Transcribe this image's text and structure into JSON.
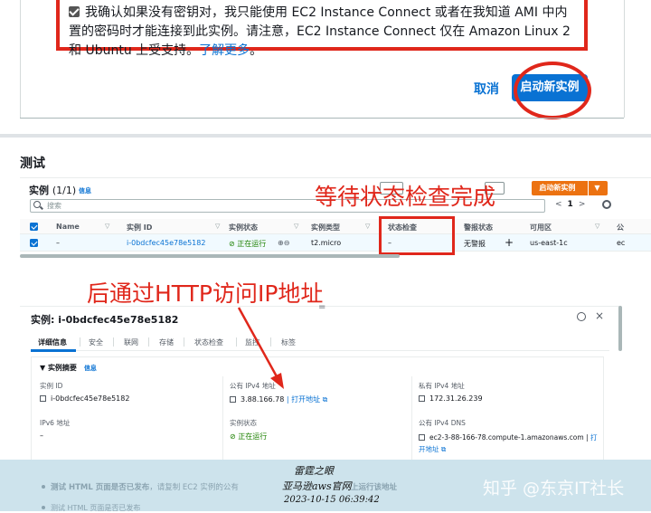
{
  "confirm_dialog": {
    "ack_text": "我确认如果没有密钥对，我只能使用 EC2 Instance Connect 或者在我知道 AMI 中内置的密码时才能连接到此实例。请注意，EC2 Instance Connect 仅在 Amazon Linux 2 和 Ubuntu 上受支持。",
    "learn_more": "了解更多",
    "learn_more_suffix": "。",
    "cancel_label": "取消",
    "launch_label": "启动新实例"
  },
  "section_heading": "测试",
  "instances": {
    "title": "实例",
    "count": "(1/1)",
    "info": "信息",
    "launch_label": "启动新实例",
    "search_placeholder": "搜索",
    "pager_prev": "<",
    "pager_page": "1",
    "pager_next": ">",
    "columns": [
      "Name",
      "实例 ID",
      "实例状态",
      "实例类型",
      "状态检查",
      "警报状态",
      "可用区",
      "公"
    ],
    "row": {
      "name": "–",
      "instance_id": "i-0bdcfec45e78e5182",
      "state": "⊘ 正在运行",
      "zoom": "⊕⊖",
      "type": "t2.micro",
      "status_check": "–",
      "alarm": "无警报",
      "alarm_add": "+",
      "az": "us-east-1c",
      "public_short": "ec"
    }
  },
  "annotations": {
    "wait": "等待状态检查完成",
    "http": "后通过HTTP访问IP地址"
  },
  "detail": {
    "drag_handle": "=",
    "title": "实例: i-0bdcfec45e78e5182",
    "close": "×",
    "tabs": [
      "详细信息",
      "安全",
      "联网",
      "存储",
      "状态检查",
      "监控",
      "标签"
    ],
    "summary_title": "▼ 实例摘要",
    "summary_info": "信息",
    "instance_id_label": "实例 ID",
    "instance_id_value": "i-0bdcfec45e78e5182",
    "ipv6_label": "IPv6 地址",
    "ipv6_value": "–",
    "public_ip_label": "公有 IPv4 地址",
    "public_ip_value": "3.88.166.78",
    "public_ip_open": "| 打开地址 ⧉",
    "state_label": "实例状态",
    "state_value": "⊘ 正在运行",
    "private_ip_label": "私有 IPv4 地址",
    "private_ip_value": "172.31.26.239",
    "public_dns_label": "公有 IPv4 DNS",
    "public_dns_value": "ec2-3-88-166-78.compute-1.amazonaws.com |",
    "public_dns_open_1": "打",
    "public_dns_open_2": "开地址 ⧉"
  },
  "footer": {
    "line1": "雷霆之眼",
    "line2": "亚马逊aws官网",
    "line3": "2023-10-15 06:39:42",
    "watermark": "知乎 @东京IT社长",
    "faded_line1_bold": "测试 HTML 页面是否已发布",
    "faded_line1": "，请复制 EC2 实例的公有",
    "faded_line1_tail": "上运行该地址",
    "faded_line2": "测试 HTML 页面是否已发布"
  }
}
